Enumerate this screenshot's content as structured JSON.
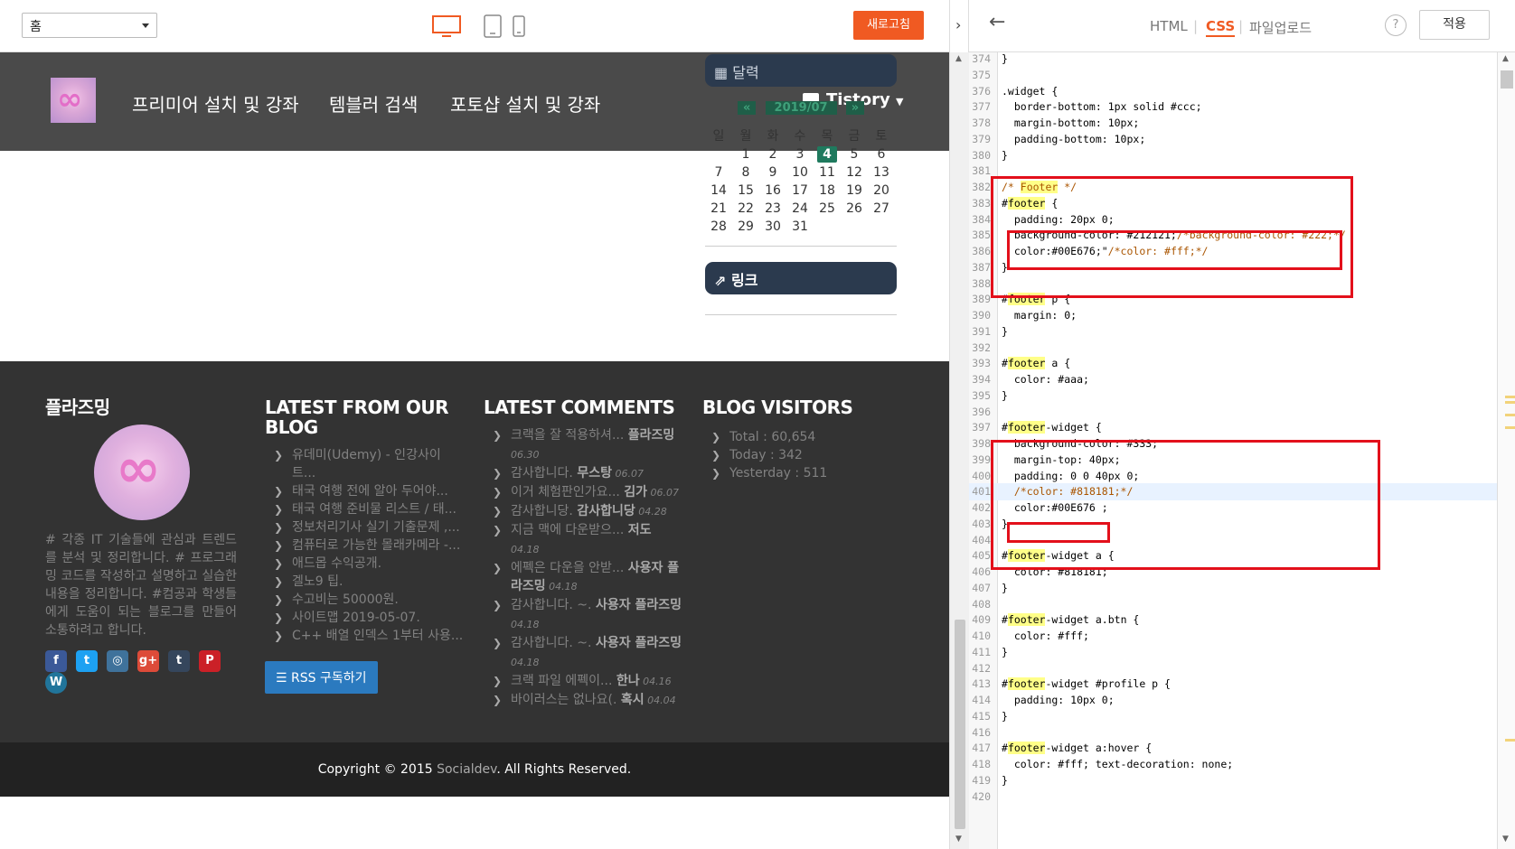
{
  "preview_toolbar": {
    "page_select": "홈",
    "refresh_label": "새로고침",
    "collapse_icon": "chevron-right-icon"
  },
  "editor_toolbar": {
    "tabs": [
      "HTML",
      "CSS",
      "파일업로드"
    ],
    "active_tab": "CSS",
    "help_label": "?",
    "apply_label": "적용"
  },
  "blog": {
    "nav": [
      "프리미어 설치 및 강좌",
      "템블러 검색",
      "포토샵 설치 및 강좌"
    ],
    "tistory_menu": "Tistory",
    "calendar": {
      "widget_label": "달력",
      "prev": "«",
      "month": "2019/07",
      "next": "»",
      "weekdays": [
        "일",
        "월",
        "화",
        "수",
        "목",
        "금",
        "토"
      ],
      "days": [
        "",
        "1",
        "2",
        "3",
        "4",
        "5",
        "6",
        "7",
        "8",
        "9",
        "10",
        "11",
        "12",
        "13",
        "14",
        "15",
        "16",
        "17",
        "18",
        "19",
        "20",
        "21",
        "22",
        "23",
        "24",
        "25",
        "26",
        "27",
        "28",
        "29",
        "30",
        "31"
      ],
      "today": "4"
    },
    "link_widget_label": "링크"
  },
  "footer": {
    "profile": {
      "title": "플라즈밍",
      "text": "# 각종 IT 기술들에 관심과 트렌드를 분석 및 정리합니다. # 프로그래밍 코드를 작성하고 설명하고 실습한 내용을 정리합니다. #컴공과 학생들에게 도움이 되는 블로그를 만들어 소통하려고 합니다.",
      "social": [
        "f",
        "t",
        "◎",
        "g+",
        "t",
        "P",
        "W"
      ],
      "social_colors": [
        "#3b5998",
        "#1da1f2",
        "#3f729b",
        "#dd4b39",
        "#35465c",
        "#cb2027",
        "#21759b"
      ]
    },
    "latest_blog": {
      "title": "LATEST FROM OUR BLOG",
      "items": [
        "유데미(Udemy) - 인강사이트...",
        "태국 여행 전에 알아 두어야...",
        "태국 여행 준비물 리스트 / 태...",
        "정보처리기사 실기 기출문제 ,...",
        "컴퓨터로 가능한 몰래카메라 -...",
        "애드몹 수익공개.",
        "겔노9 팁.",
        "수고비는 50000원.",
        "사이트맵 2019-05-07.",
        "C++ 배열 인덱스 1부터 사용..."
      ],
      "rss_label": "RSS 구독하기"
    },
    "latest_comments": {
      "title": "LATEST COMMENTS",
      "items": [
        {
          "text": "크랙을 잘 적용하셔...",
          "author": "플라즈밍",
          "date": "06.30"
        },
        {
          "text": "감사합니다.",
          "author": "무스탕",
          "date": "06.07"
        },
        {
          "text": "이거 체험판인가요...",
          "author": "김가",
          "date": "06.07"
        },
        {
          "text": "감사합니당.",
          "author": "감사합니당",
          "date": "04.28"
        },
        {
          "text": "지금 맥에 다운받으...",
          "author": "저도",
          "date": "04.18"
        },
        {
          "text": "에펙은 다운을 안받...",
          "author": "사용자 플라즈밍",
          "date": "04.18"
        },
        {
          "text": "감사합니다. ~.",
          "author": "사용자 플라즈밍",
          "date": "04.18"
        },
        {
          "text": "감사합니다. ~.",
          "author": "사용자 플라즈밍",
          "date": "04.18"
        },
        {
          "text": "크랙 파일 에펙이...",
          "author": "한나",
          "date": "04.16"
        },
        {
          "text": "바이러스는 없나요(.",
          "author": "혹시",
          "date": "04.04"
        }
      ]
    },
    "visitors": {
      "title": "BLOG VISITORS",
      "items": [
        "Total : 60,654",
        "Today : 342",
        "Yesterday : 511"
      ]
    },
    "copyright_prefix": "Copyright © 2015",
    "copyright_brand": "Socialdev",
    "copyright_suffix": ". All Rights Reserved."
  },
  "code": {
    "lines": [
      {
        "n": "374",
        "t": "}"
      },
      {
        "n": "375",
        "t": ""
      },
      {
        "n": "376",
        "t": ".widget {"
      },
      {
        "n": "377",
        "t": "  border-bottom: 1px solid #ccc;"
      },
      {
        "n": "378",
        "t": "  margin-bottom: 10px;"
      },
      {
        "n": "379",
        "t": "  padding-bottom: 10px;"
      },
      {
        "n": "380",
        "t": "}"
      },
      {
        "n": "381",
        "t": ""
      },
      {
        "n": "382",
        "t": "/* Footer */"
      },
      {
        "n": "383",
        "t": "#footer {"
      },
      {
        "n": "384",
        "t": "  padding: 20px 0;"
      },
      {
        "n": "385",
        "t": "  background-color: #212121;/*background-color: #222;*/"
      },
      {
        "n": "386",
        "t": "  color:#00E676;\"/*color: #fff;*/"
      },
      {
        "n": "387",
        "t": "}"
      },
      {
        "n": "388",
        "t": ""
      },
      {
        "n": "389",
        "t": "#footer p {"
      },
      {
        "n": "390",
        "t": "  margin: 0;"
      },
      {
        "n": "391",
        "t": "}"
      },
      {
        "n": "392",
        "t": ""
      },
      {
        "n": "393",
        "t": "#footer a {"
      },
      {
        "n": "394",
        "t": "  color: #aaa;"
      },
      {
        "n": "395",
        "t": "}"
      },
      {
        "n": "396",
        "t": ""
      },
      {
        "n": "397",
        "t": "#footer-widget {"
      },
      {
        "n": "398",
        "t": "  background-color: #333;"
      },
      {
        "n": "399",
        "t": "  margin-top: 40px;"
      },
      {
        "n": "400",
        "t": "  padding: 0 0 40px 0;"
      },
      {
        "n": "401",
        "t": "  /*color: #818181;*/"
      },
      {
        "n": "402",
        "t": "  color:#00E676 ;"
      },
      {
        "n": "403",
        "t": "}"
      },
      {
        "n": "404",
        "t": ""
      },
      {
        "n": "405",
        "t": "#footer-widget a {"
      },
      {
        "n": "406",
        "t": "  color: #818181;"
      },
      {
        "n": "407",
        "t": "}"
      },
      {
        "n": "408",
        "t": ""
      },
      {
        "n": "409",
        "t": "#footer-widget a.btn {"
      },
      {
        "n": "410",
        "t": "  color: #fff;"
      },
      {
        "n": "411",
        "t": "}"
      },
      {
        "n": "412",
        "t": ""
      },
      {
        "n": "413",
        "t": "#footer-widget #profile p {"
      },
      {
        "n": "414",
        "t": "  padding: 10px 0;"
      },
      {
        "n": "415",
        "t": "}"
      },
      {
        "n": "416",
        "t": ""
      },
      {
        "n": "417",
        "t": "#footer-widget a:hover {"
      },
      {
        "n": "418",
        "t": "  color: #fff; text-decoration: none;"
      },
      {
        "n": "419",
        "t": "}"
      },
      {
        "n": "420",
        "t": ""
      }
    ]
  },
  "colors": {
    "accent": "#f05a22",
    "highlight_box": "#e3101b",
    "nav_bg": "#4a4a4a",
    "footer_bg": "#333333",
    "copyright_bg": "#222222",
    "widget_btn_bg": "#2b3a4e"
  }
}
